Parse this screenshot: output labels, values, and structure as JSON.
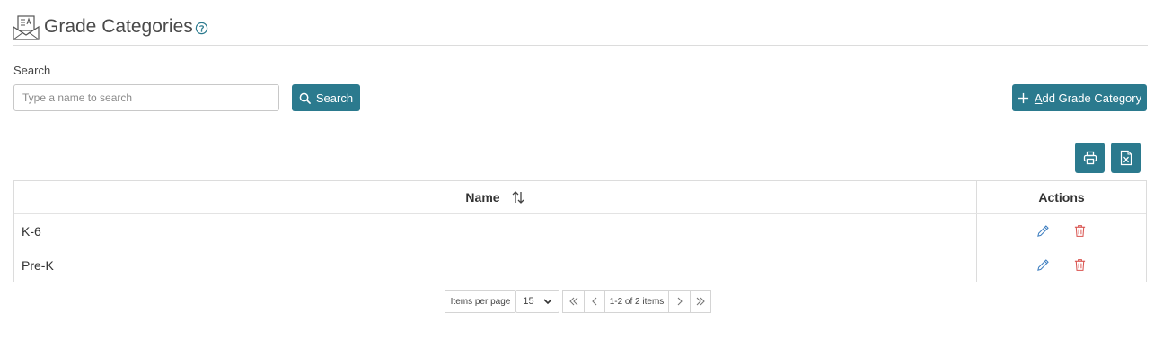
{
  "header": {
    "title": "Grade Categories",
    "icon": "certificate-icon",
    "help_icon": "question-circle-icon"
  },
  "search": {
    "label": "Search",
    "placeholder": "Type a name to search",
    "button_label": "Search",
    "value": ""
  },
  "toolbar": {
    "add_button_label": "Add Grade Category",
    "add_button_underlined_letter": "A",
    "add_button_rest": "dd Grade Category",
    "print_icon": "printer-icon",
    "export_icon": "excel-file-icon"
  },
  "grid": {
    "columns": {
      "name": "Name",
      "actions": "Actions"
    },
    "rows": [
      {
        "name": "K-6"
      },
      {
        "name": "Pre-K"
      }
    ]
  },
  "pager": {
    "items_per_page_label": "Items per page",
    "page_size": "15",
    "info": "1-2 of 2 items"
  },
  "colors": {
    "accent": "#2b7a8e",
    "edit_icon": "#3f7fc0",
    "delete_icon": "#d9534f"
  }
}
